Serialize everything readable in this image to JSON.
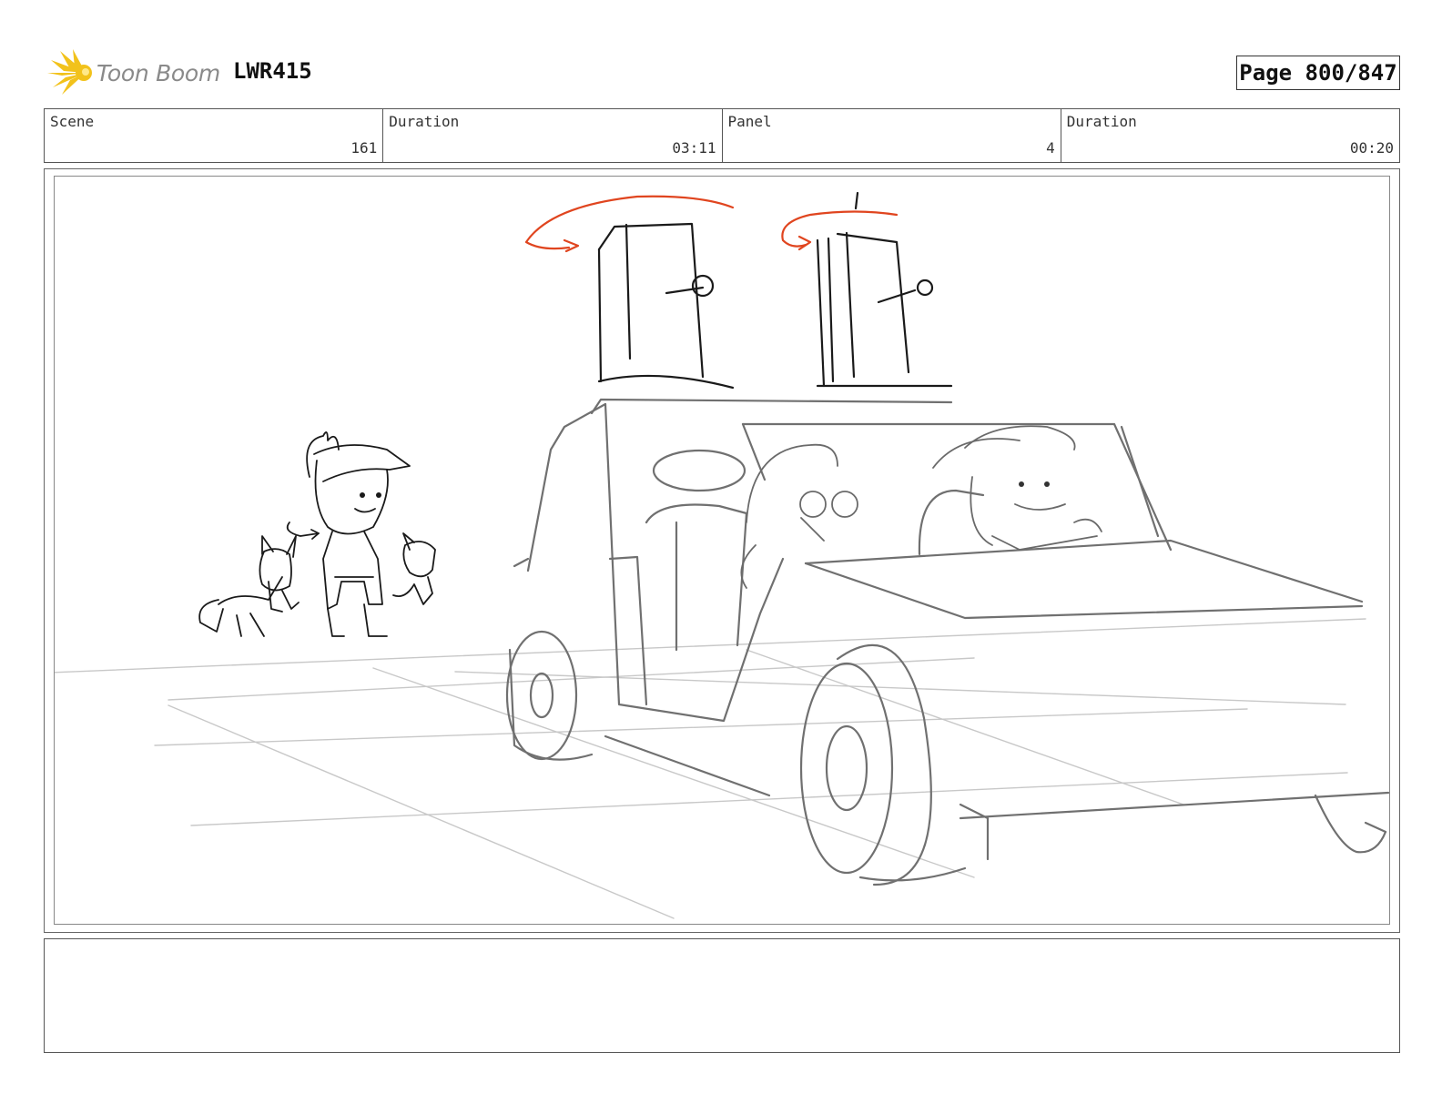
{
  "header": {
    "logo_text": "Toon Boom",
    "project": "LWR415",
    "page_label": "Page 800/847"
  },
  "info": [
    {
      "label": "Scene",
      "value": "161"
    },
    {
      "label": "Duration",
      "value": "03:11"
    },
    {
      "label": "Panel",
      "value": "4"
    },
    {
      "label": "Duration",
      "value": "00:20"
    }
  ],
  "notes": {
    "text": ""
  },
  "colors": {
    "logo_accent": "#f2c21b",
    "sketch": "#6e6e6e",
    "ink": "#1a1a1a",
    "arrow": "#e0451f",
    "ground": "#c8c8c8"
  }
}
